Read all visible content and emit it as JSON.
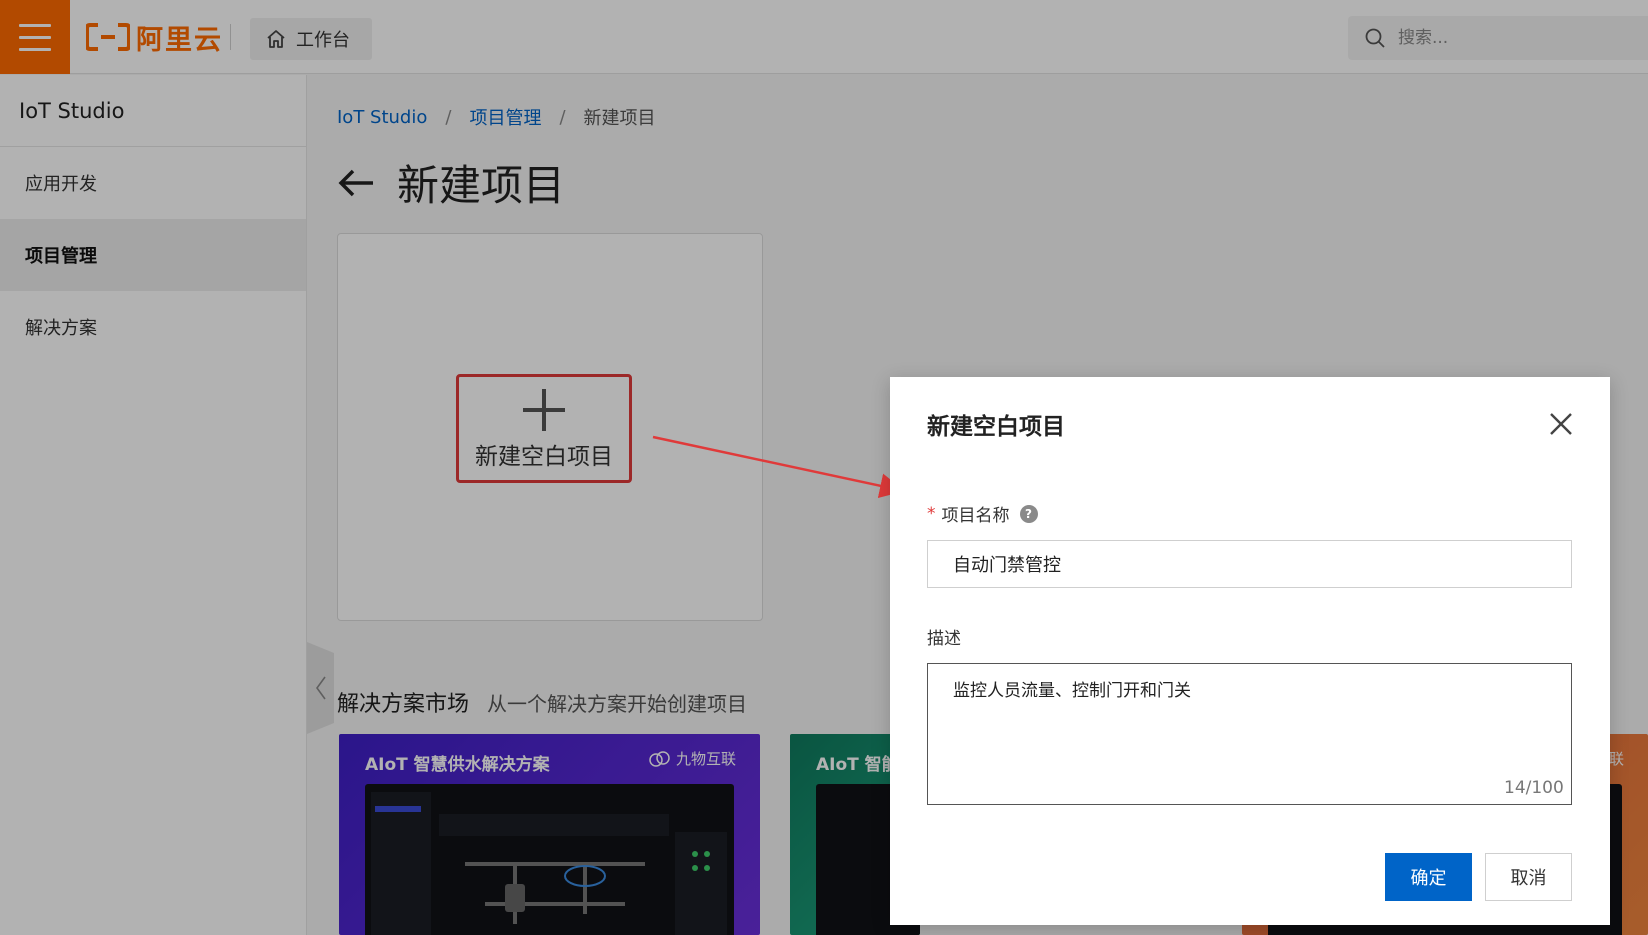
{
  "header": {
    "logo_text": "阿里云",
    "workbench_label": "工作台",
    "search_placeholder": "搜索..."
  },
  "sidebar": {
    "title": "IoT Studio",
    "items": [
      {
        "label": "应用开发",
        "active": false
      },
      {
        "label": "项目管理",
        "active": true
      },
      {
        "label": "解决方案",
        "active": false
      }
    ]
  },
  "breadcrumb": {
    "items": [
      "IoT Studio",
      "项目管理",
      "新建项目"
    ],
    "separator": "/"
  },
  "page": {
    "title": "新建项目",
    "blank_project_label": "新建空白项目",
    "market_title": "解决方案市场",
    "market_subtitle": "从一个解决方案开始创建项目"
  },
  "solutions": [
    {
      "title": "AIoT 智慧供水解决方案",
      "brand": "九物互联",
      "color": "#4a22d0"
    },
    {
      "title": "AIoT 智能",
      "brand": "",
      "color": "#138a68"
    },
    {
      "title": "",
      "brand": "互联",
      "color": "#e86e3c"
    }
  ],
  "dialog": {
    "title": "新建空白项目",
    "name_label": "项目名称",
    "name_required_mark": "*",
    "name_value": "自动门禁管控",
    "desc_label": "描述",
    "desc_value": "监控人员流量、控制门开和门关",
    "char_count": "14/100",
    "ok_label": "确定",
    "cancel_label": "取消"
  },
  "colors": {
    "brand_orange": "#ff6a00",
    "primary_blue": "#0064c8",
    "annotation_red": "#e03a3a"
  }
}
